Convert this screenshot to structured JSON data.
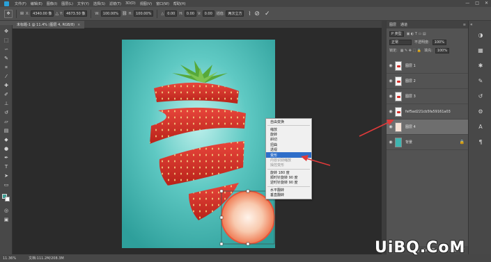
{
  "menubar": {
    "items": [
      "文件(F)",
      "编辑(E)",
      "图像(I)",
      "图层(L)",
      "文字(Y)",
      "选择(S)",
      "滤镜(T)",
      "3D(D)",
      "视图(V)",
      "窗口(W)",
      "帮助(H)"
    ],
    "window_controls": [
      "—",
      "□",
      "✕"
    ]
  },
  "options": {
    "x_label": "X:",
    "x_value": "4340.00 像",
    "y_label": "Y:",
    "y_value": "4673.50 像",
    "w_label": "W:",
    "w_value": "100.00%",
    "h_label": "H:",
    "h_value": "100.00%",
    "angle_label": "△",
    "angle_value": "0.00",
    "hskew_label": "H:",
    "hskew_value": "0.00",
    "vskew_label": "V:",
    "vskew_value": "0.00",
    "interp_label": "插值:",
    "interp_value": "两次立方",
    "commit": "✓",
    "cancel": "⊘"
  },
  "document": {
    "tab_title": "未标题-1 @ 11.4% (图层 4, RGB/8)",
    "tab_close": "×",
    "zoom": "11.36%",
    "doc_info": "文档:111.2M/208.3M"
  },
  "context_menu": {
    "items": [
      {
        "label": "自由变换",
        "state": "normal"
      },
      {
        "sep": true
      },
      {
        "label": "缩放",
        "state": "normal"
      },
      {
        "label": "旋转",
        "state": "normal"
      },
      {
        "label": "斜切",
        "state": "normal"
      },
      {
        "label": "扭曲",
        "state": "normal"
      },
      {
        "label": "透视",
        "state": "normal"
      },
      {
        "label": "变形",
        "state": "highlighted"
      },
      {
        "label": "内容识别缩放",
        "state": "disabled"
      },
      {
        "label": "操控变形",
        "state": "disabled"
      },
      {
        "sep": true
      },
      {
        "label": "旋转 180 度",
        "state": "normal"
      },
      {
        "label": "顺时针旋转 90 度",
        "state": "normal"
      },
      {
        "label": "逆时针旋转 90 度",
        "state": "normal"
      },
      {
        "sep": true
      },
      {
        "label": "水平翻转",
        "state": "normal"
      },
      {
        "label": "垂直翻转",
        "state": "normal"
      }
    ]
  },
  "layers_panel": {
    "tabs": [
      "图层",
      "通道"
    ],
    "filter_kind": "P 类型",
    "blend_mode": "正常",
    "opacity_label": "不透明度:",
    "opacity_value": "100%",
    "lock_label": "锁定:",
    "fill_label": "填充:",
    "fill_value": "100%",
    "layers": [
      {
        "name": "图层 1",
        "visible": true,
        "selected": false,
        "thumb": "strawberry"
      },
      {
        "name": "图层 2",
        "visible": true,
        "selected": false,
        "thumb": "strawberry"
      },
      {
        "name": "图层 3",
        "visible": true,
        "selected": false,
        "thumb": "strawberry"
      },
      {
        "name": "fef5ad221cb5fa59161a03",
        "visible": true,
        "selected": false,
        "thumb": "strawberry"
      },
      {
        "name": "图层 4",
        "visible": true,
        "selected": true,
        "thumb": "slice"
      },
      {
        "name": "背景",
        "visible": true,
        "selected": false,
        "thumb": "background",
        "locked": true
      }
    ],
    "footer_icons": [
      "link-icon",
      "fx-icon",
      "mask-icon",
      "adjustment-icon",
      "folder-icon",
      "new-layer-icon",
      "trash-icon"
    ]
  },
  "colors": {
    "canvas_bg": "#2b2b2b",
    "teal": "#3fb6b1",
    "strawberry": "#d4302a",
    "highlight": "#2e6ec9",
    "arrow": "#e03a3a"
  },
  "watermark": "UiBQ.CoM"
}
